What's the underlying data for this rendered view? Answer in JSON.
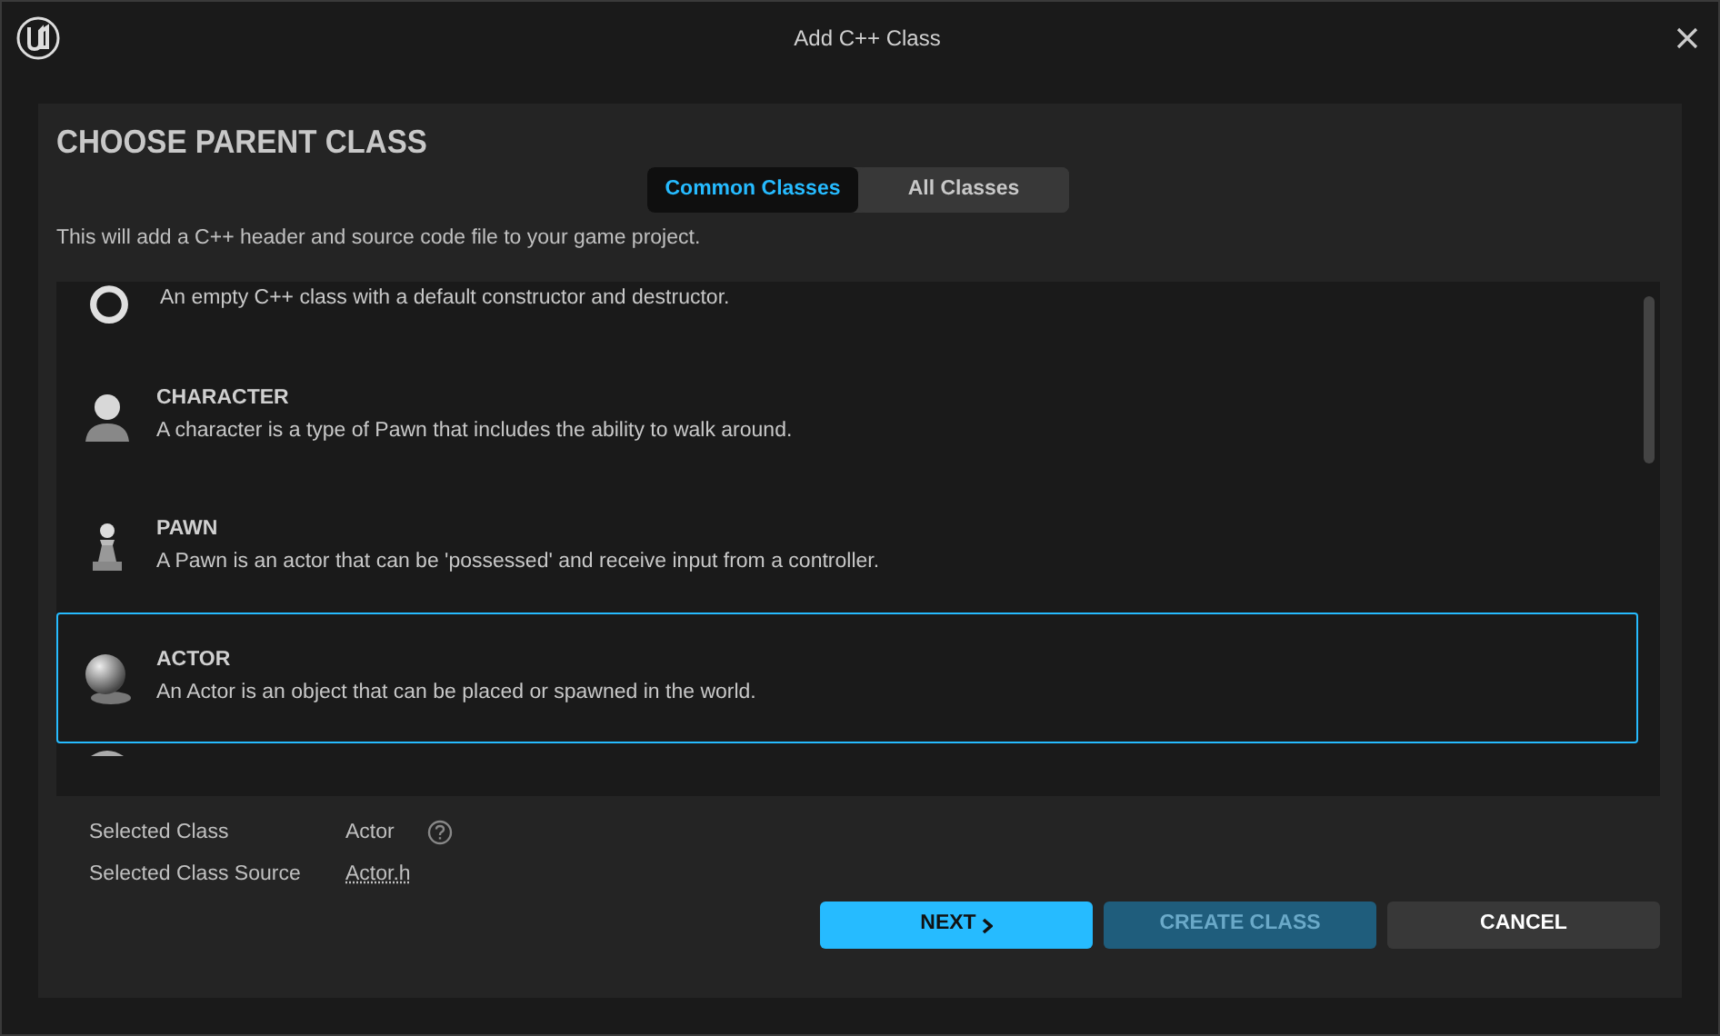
{
  "window": {
    "title": "Add C++ Class"
  },
  "heading": "CHOOSE PARENT CLASS",
  "tabs": [
    {
      "label": "Common Classes",
      "selected": true
    },
    {
      "label": "All Classes",
      "selected": false
    }
  ],
  "intro": "This will add a C++ header and source code file to your game project.",
  "classes": [
    {
      "kind": "ring",
      "description": "An empty C++ class with a default constructor and destructor.",
      "selected": false
    },
    {
      "kind": "character",
      "title": "CHARACTER",
      "description": "A character is a type of Pawn that includes the ability to walk around.",
      "selected": false
    },
    {
      "kind": "pawn",
      "title": "PAWN",
      "description": "A Pawn is an actor that can be 'possessed' and receive input from a controller.",
      "selected": false
    },
    {
      "kind": "sphere",
      "title": "ACTOR",
      "description": "An Actor is an object that can be placed or spawned in the world.",
      "selected": true
    },
    {
      "kind": "partial",
      "selected": false
    }
  ],
  "details": [
    {
      "label": "Selected Class",
      "value": "Actor",
      "help": true
    },
    {
      "label": "Selected Class Source",
      "value": "Actor.h",
      "link": true
    }
  ],
  "buttons": [
    {
      "label": "NEXT",
      "kind": "primary",
      "disabled": false
    },
    {
      "label": "CREATE CLASS",
      "kind": "primary",
      "disabled": true
    },
    {
      "label": "CANCEL",
      "kind": "secondary",
      "disabled": false
    }
  ]
}
